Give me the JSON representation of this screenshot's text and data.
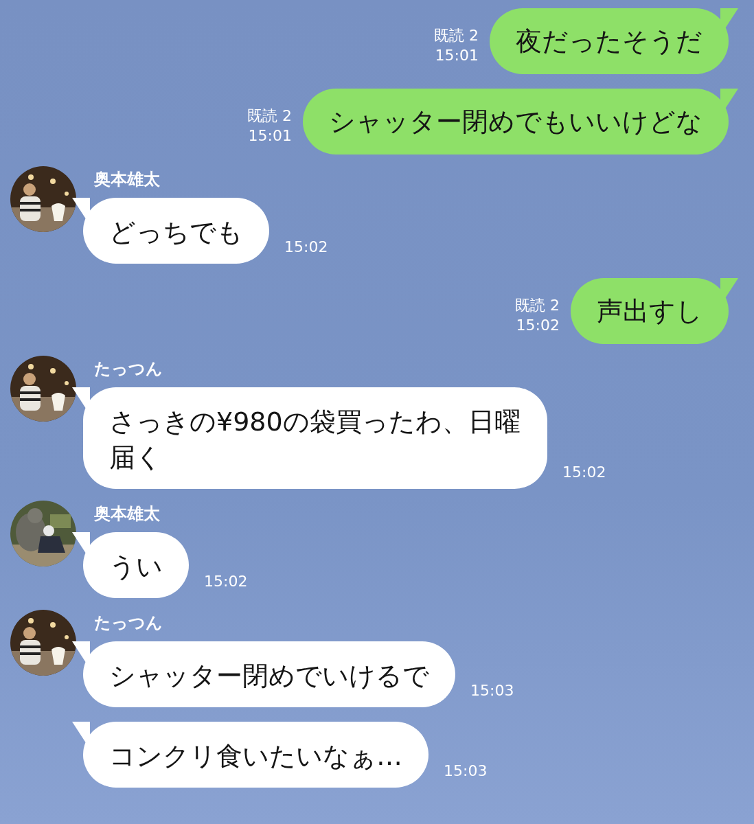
{
  "messages": [
    {
      "kind": "sent",
      "text": "夜だったそうだ",
      "read": "既読 2",
      "time": "15:01"
    },
    {
      "kind": "sent",
      "text": "シャッター閉めでもいいけどな",
      "read": "既読 2",
      "time": "15:01"
    },
    {
      "kind": "received",
      "sender": "奥本雄太",
      "text": "どっちでも",
      "time": "15:02"
    },
    {
      "kind": "sent",
      "text": "声出すし",
      "read": "既読 2",
      "time": "15:02"
    },
    {
      "kind": "received",
      "sender": "たっつん",
      "text": "さっきの¥980の袋買ったわ、日曜届く",
      "time": "15:02"
    },
    {
      "kind": "received",
      "sender": "奥本雄太",
      "text": "うい",
      "time": "15:02"
    },
    {
      "kind": "received",
      "sender": "たっつん",
      "text": "シャッター閉めでいけるで",
      "time": "15:03"
    },
    {
      "kind": "received",
      "text": "コンクリ食いたいなぁ…",
      "time": "15:03"
    }
  ]
}
